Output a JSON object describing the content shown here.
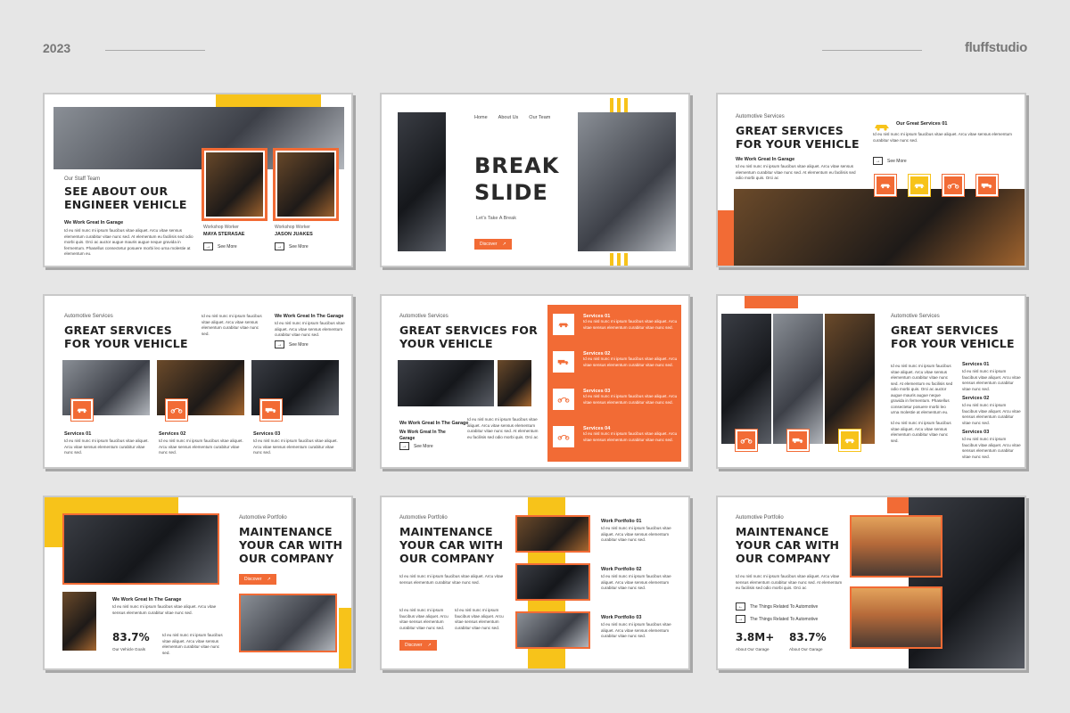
{
  "header": {
    "year": "2023",
    "brand": "fluffstudio"
  },
  "lorem": {
    "p4": "Id eu nisl nunc mi ipsum faucibus vitae aliquet. Arcu vitae sensus elementum curabitur vitae nunc sed. At elementum eu facilisis sed odio morbi quis. Orci ac auctor augue mauris augue neque gravida in fermentum. Phasellus consectetur posuere morbi leo urna molestie at elementum eu.",
    "p3": "Id eu nisl nunc mi ipsum faucibus vitae aliquet. Arcu vitae sensus elementum curabitur vitae nunc sed. At elementum eu facilisis sed odio morbi quis. Orci ac",
    "p2": "Id eu nisl nunc mi ipsum faucibus vitae aliquet. Arcu vitae sensus elementum curabitur vitae nunc sed."
  },
  "slide1": {
    "kicker": "Our Staff Team",
    "title": "See About Our Engineer Vehicle",
    "sub": "We Work Great In Garage",
    "worker1_role": "Workshop Worker",
    "worker1_name": "MAYA STERASAE",
    "worker2_role": "Workshop Worker",
    "worker2_name": "JASON JUAKES",
    "see_more": "See More"
  },
  "slide2": {
    "nav": [
      "Home",
      "About Us",
      "Our Team"
    ],
    "title_line1": "Break",
    "title_line2": "Slide",
    "sub": "Let's Take A Break",
    "discover": "Discover"
  },
  "slide3": {
    "kicker": "Automotive Services",
    "title": "Great Services For Your Vehicle",
    "sub": "We Work Great In Garage",
    "services_label": "Our Great Services 01",
    "see_more": "See More"
  },
  "slide4": {
    "kicker": "Automotive Services",
    "title": "Great Services For Your Vehicle",
    "sub": "We Work Great In The Garage",
    "see_more": "See More",
    "services": [
      "Services 01",
      "Services 02",
      "Services 03"
    ]
  },
  "slide5": {
    "kicker": "Automotive Services",
    "title": "Great Services For Your Vehicle",
    "sub1": "We Work Great In The Garage",
    "sub2": "We Work Great In The Garage",
    "see_more": "See More",
    "services": [
      "Services 01",
      "Services 02",
      "Services 03",
      "Services 04"
    ]
  },
  "slide6": {
    "kicker": "Automotive Services",
    "title": "Great Services For Your Vehicle",
    "services": [
      "Services 01",
      "Services 02",
      "Services 03"
    ]
  },
  "slide7": {
    "kicker": "Automotive Portfolio",
    "title": "Maintenance Your Car With Our Company",
    "discover": "Discover",
    "sub": "We Work Great In The Garage",
    "stat": "83.7%",
    "stat_label": "Our Vehicle Goals"
  },
  "slide8": {
    "kicker": "Automotive Portfolio",
    "title": "Maintenance Your Car With Our Company",
    "discover": "Discover",
    "portfolio": [
      "Work Portfolio 01",
      "Work Portfolio 02",
      "Work Portfolio 03"
    ]
  },
  "slide9": {
    "kicker": "Automotive Portfolio",
    "title": "Maintenance Your Car With Our Company",
    "link1": "The Things Related To Automotive",
    "link2": "The Things Related To Automotive",
    "stat1": "3.8M+",
    "stat1_label": "About Our Garage",
    "stat2": "83.7%",
    "stat2_label": "About Our Garage"
  },
  "icons": [
    "car-icon",
    "motorbike-icon",
    "truck-icon",
    "arrow-right-icon"
  ],
  "colors": {
    "accent_orange": "#f26b35",
    "accent_yellow": "#f7c31a"
  }
}
